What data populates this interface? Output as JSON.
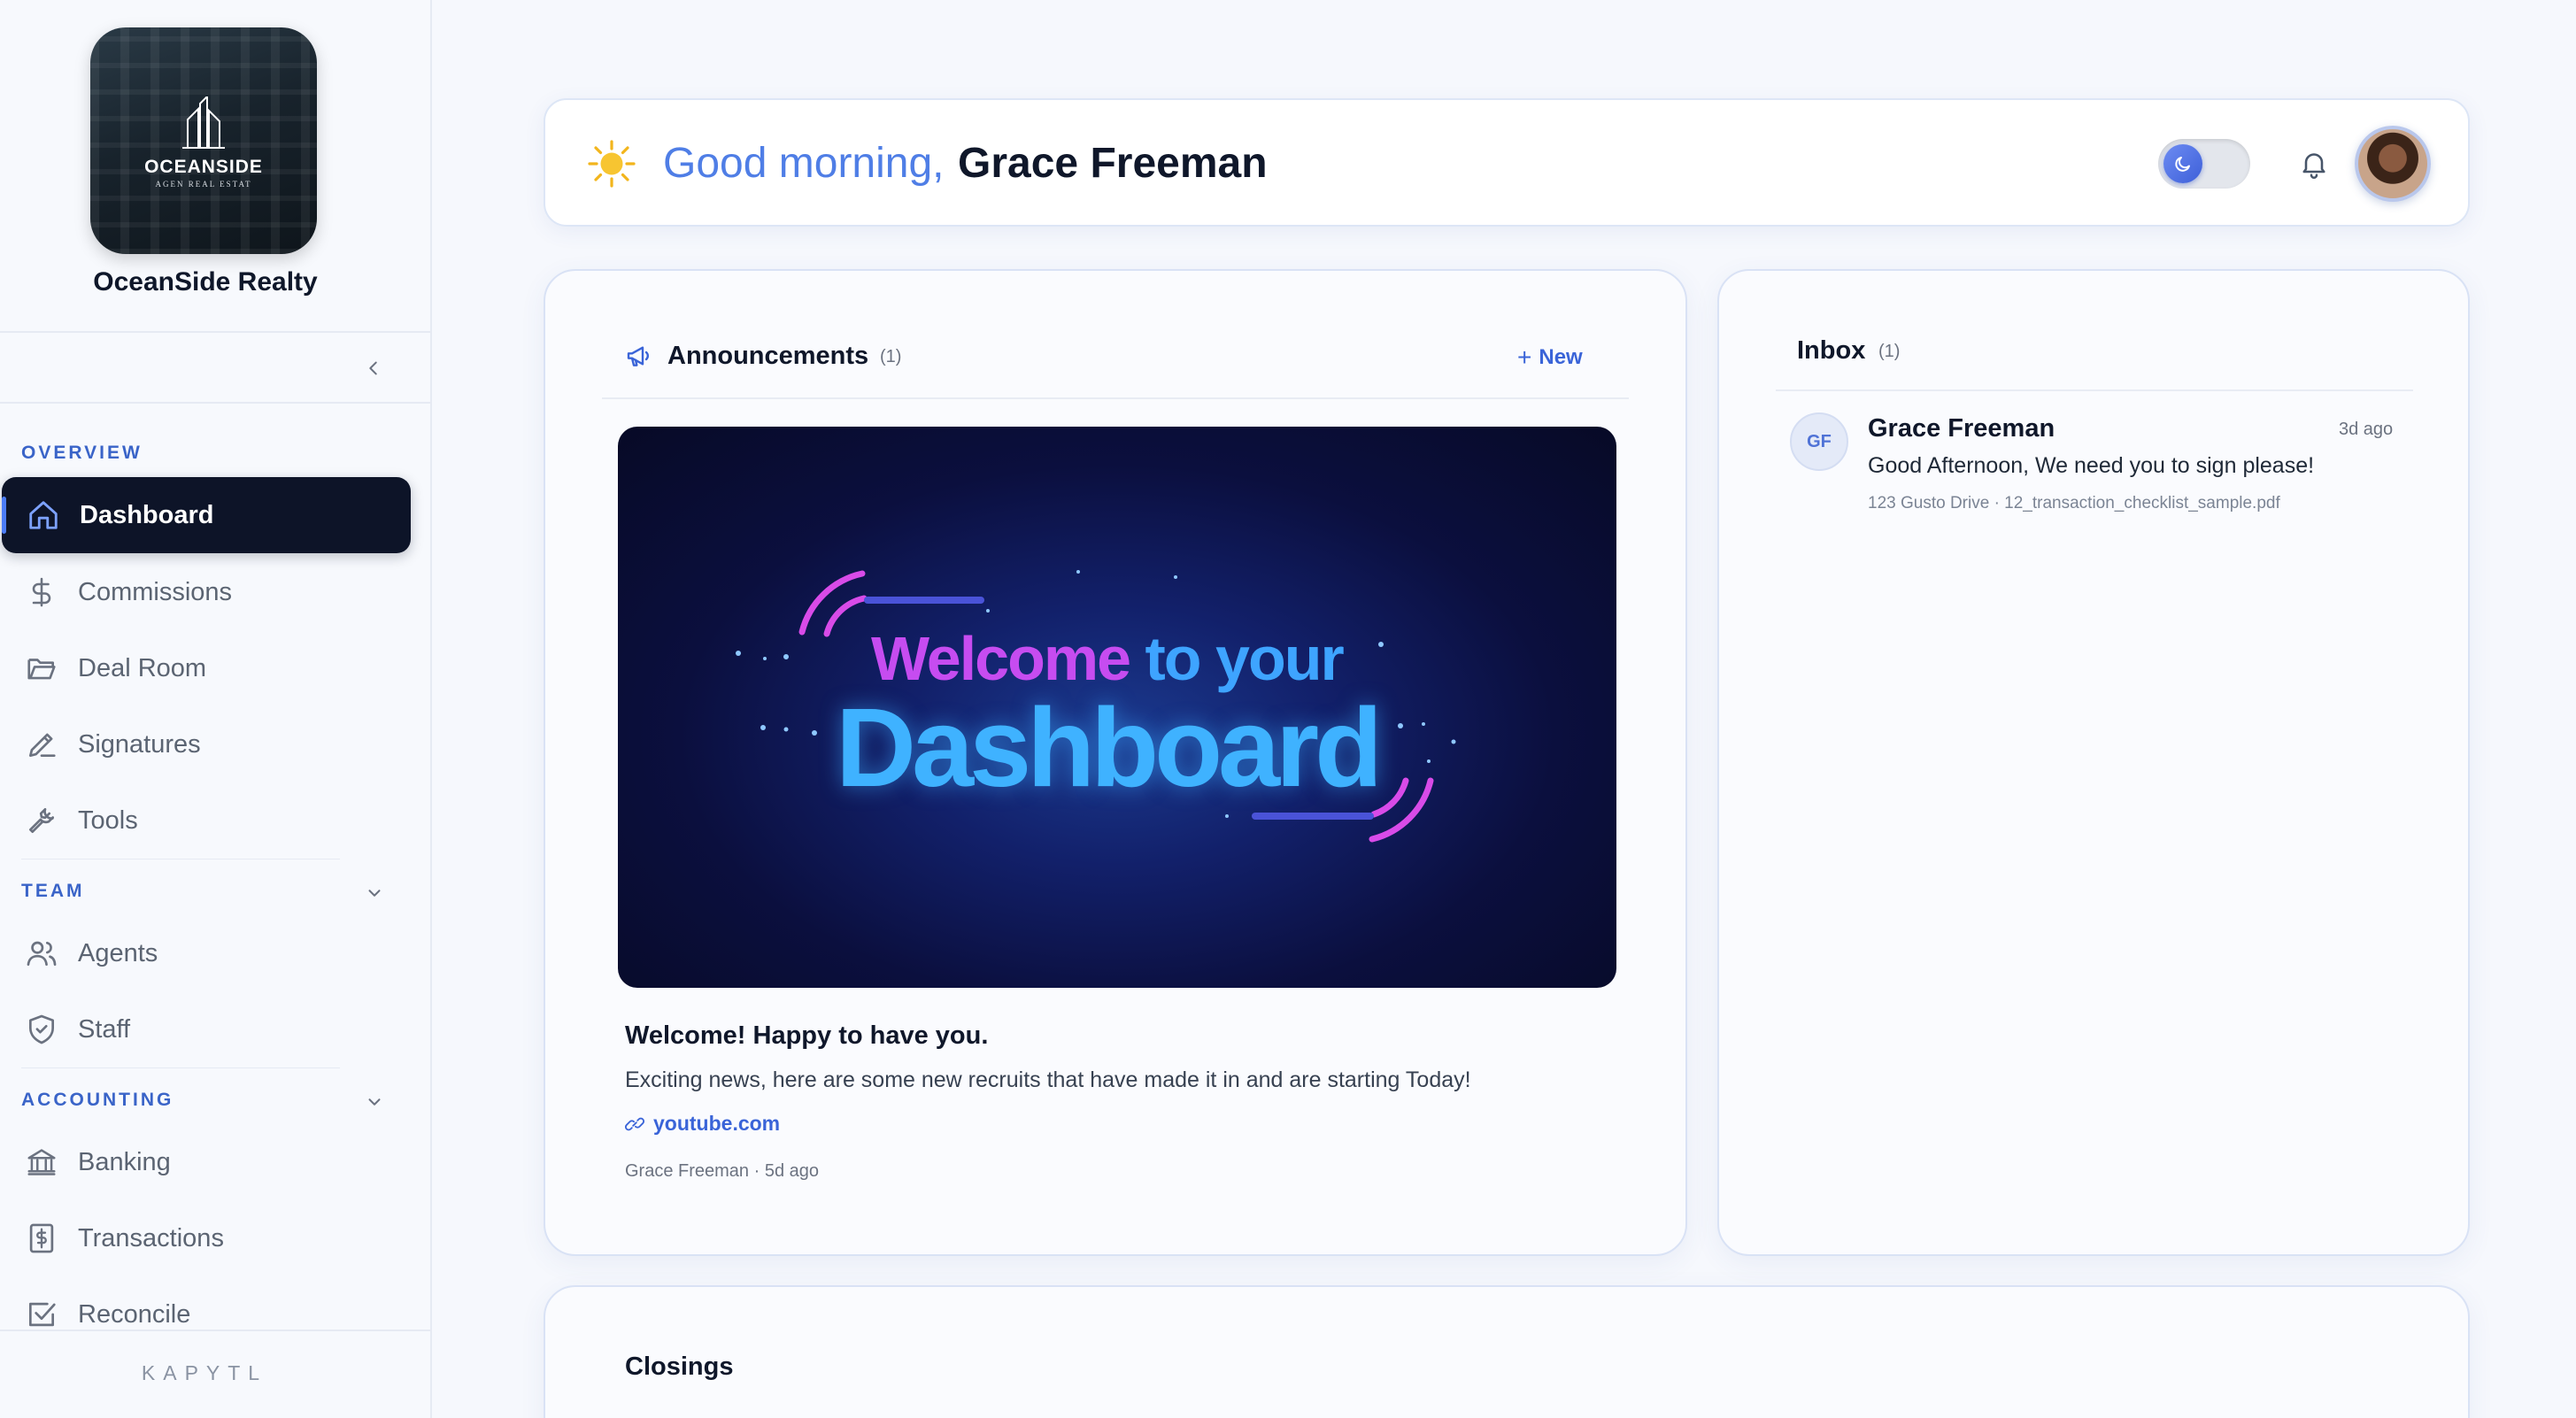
{
  "sidebar": {
    "logo": {
      "brand": "OCEANSIDE",
      "sub": "AGEN REAL ESTAT"
    },
    "org_name": "OceanSide Realty",
    "sections": {
      "overview": "OVERVIEW",
      "team": "TEAM",
      "accounting": "ACCOUNTING"
    },
    "items": [
      {
        "label": "Dashboard",
        "icon": "home-icon",
        "active": true
      },
      {
        "label": "Commissions",
        "icon": "dollar-icon"
      },
      {
        "label": "Deal Room",
        "icon": "folder-icon"
      },
      {
        "label": "Signatures",
        "icon": "pen-icon"
      },
      {
        "label": "Tools",
        "icon": "wrench-icon"
      },
      {
        "label": "Agents",
        "icon": "users-icon"
      },
      {
        "label": "Staff",
        "icon": "shield-icon"
      },
      {
        "label": "Banking",
        "icon": "bank-icon"
      },
      {
        "label": "Transactions",
        "icon": "receipt-icon"
      },
      {
        "label": "Reconcile",
        "icon": "checkbox-icon"
      }
    ],
    "footer": "KAPYTL"
  },
  "header": {
    "greeting": "Good morning,",
    "name": "Grace Freeman",
    "icons": [
      "sun-icon",
      "moon-icon",
      "bell-icon"
    ]
  },
  "announcements": {
    "title": "Announcements",
    "count": "(1)",
    "new_label": "New",
    "banner": {
      "line1a": "Welcome",
      "line1b": "to your",
      "line2": "Dashboard"
    },
    "post": {
      "title": "Welcome! Happy to have you.",
      "body": "Exciting news, here are some new recruits that have made it in and are starting Today!",
      "link": "youtube.com",
      "meta": "Grace Freeman · 5d ago"
    }
  },
  "inbox": {
    "title": "Inbox",
    "count": "(1)",
    "messages": [
      {
        "initials": "GF",
        "name": "Grace Freeman",
        "time": "3d ago",
        "text": "Good Afternoon, We need you to sign please!",
        "meta": "123 Gusto Drive · 12_transaction_checklist_sample.pdf"
      }
    ]
  },
  "closings": {
    "title": "Closings"
  },
  "colors": {
    "accent": "#3a64d8",
    "active_nav": "#0d1428",
    "greeting": "#4f7ee6"
  }
}
